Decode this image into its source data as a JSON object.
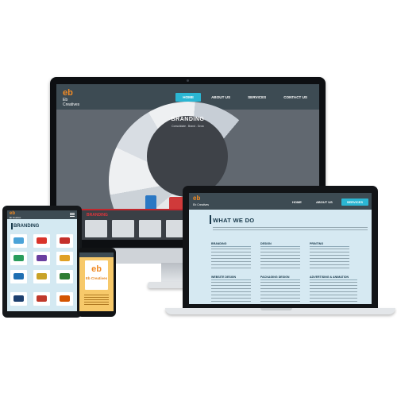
{
  "brand": {
    "mark": "eb",
    "name": "Eb Creatives"
  },
  "colors": {
    "accent": "#2bb6d3",
    "nav": "#3d4b53",
    "logo_orange": "#f08a24",
    "red_tag": "#e0353c"
  },
  "desktop": {
    "menu": [
      "HOME",
      "ABOUT US",
      "SERVICES",
      "CONTACT US"
    ],
    "active_menu": "HOME",
    "hero_title": "BRANDING",
    "hero_subtitle": "Consolidate . Brand . Grow",
    "section_tag": "BRANDING"
  },
  "laptop": {
    "menu": [
      "HOME",
      "ABOUT US",
      "SERVICES"
    ],
    "active_menu": "SERVICES",
    "title": "WHAT WE DO",
    "columns": [
      {
        "heading": "BRANDING"
      },
      {
        "heading": "DESIGN"
      },
      {
        "heading": "PRINTING"
      },
      {
        "heading": "WEBSITE DESIGN"
      },
      {
        "heading": "PACKAGING DESIGN"
      },
      {
        "heading": "ADVERTISING & ANIMATION"
      }
    ]
  },
  "tablet": {
    "title": "BRANDING"
  },
  "phone": {
    "logo": "eb",
    "name": "Eb Creatives"
  }
}
